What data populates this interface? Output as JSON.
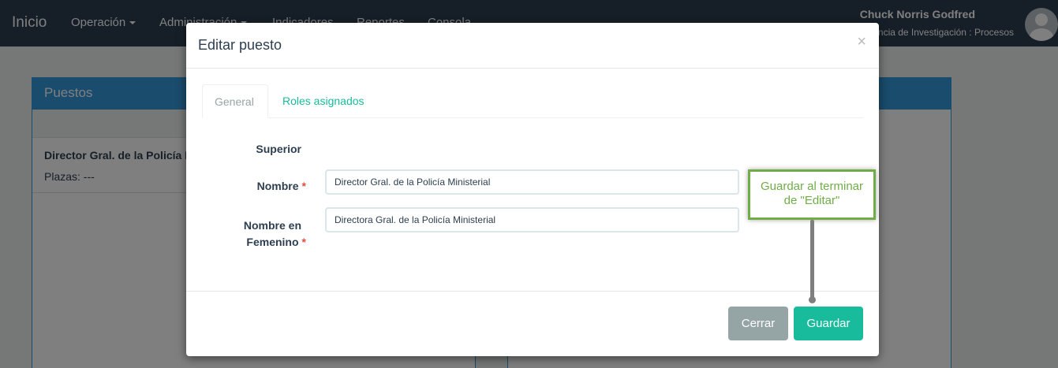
{
  "navbar": {
    "brand": "Inicio",
    "items": [
      {
        "label": "Operación"
      },
      {
        "label": "Administración"
      },
      {
        "label": "Indicadores"
      },
      {
        "label": "Reportes"
      },
      {
        "label": "Consola"
      }
    ],
    "user_name": "Chuck Norris Godfred",
    "user_role": "Agencia de Investigación : Procesos"
  },
  "background": {
    "panel_title": "Puestos",
    "row_title": "Director Gral. de la Policía Ministerial",
    "row_sub": "Plazas: ---"
  },
  "modal": {
    "title": "Editar puesto",
    "close_glyph": "×",
    "tabs": [
      {
        "label": "General",
        "active": true
      },
      {
        "label": "Roles asignados",
        "active": false
      }
    ],
    "form": {
      "superior_label": "Superior",
      "nombre_label": "Nombre",
      "nombre_value": "Director Gral. de la Policía Ministerial",
      "femenino_label_line1": "Nombre en",
      "femenino_label_line2": "Femenino",
      "femenino_value": "Directora Gral. de la Policía Ministerial",
      "required_mark": "*"
    },
    "buttons": {
      "cerrar": "Cerrar",
      "guardar": "Guardar"
    }
  },
  "callout": {
    "line1": "Guardar al terminar",
    "line2": "de \"Editar\""
  },
  "colors": {
    "navbar": "#2c3e50",
    "primary": "#18bc9c",
    "panel": "#3498db",
    "required": "#e74c3c",
    "callout": "#70ad47"
  }
}
